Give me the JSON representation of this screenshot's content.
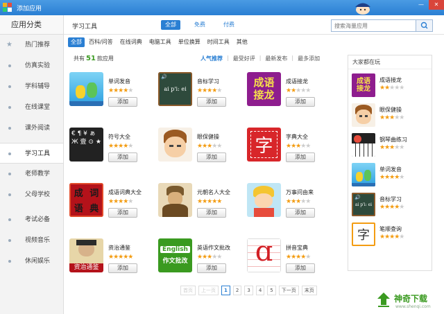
{
  "window": {
    "title": "添加应用"
  },
  "sidebar": {
    "header": "应用分类",
    "items": [
      {
        "label": "热门推荐"
      },
      {
        "label": "仿真实验"
      },
      {
        "label": "学科辅导"
      },
      {
        "label": "在线课堂"
      },
      {
        "label": "课外阅读"
      },
      {
        "label": "学习工具"
      },
      {
        "label": "老师教学"
      },
      {
        "label": "父母学校"
      },
      {
        "label": "考试必备"
      },
      {
        "label": "视频音乐"
      },
      {
        "label": "休闲娱乐"
      }
    ]
  },
  "topbar": {
    "title": "学习工具",
    "filters": [
      "全部",
      "免费",
      "付费"
    ],
    "search_placeholder": "搜索海量应用"
  },
  "subcategories": [
    "全部",
    "百科/问答",
    "在线词典",
    "电脑工具",
    "单位换算",
    "时间工具",
    "其他"
  ],
  "count": {
    "prefix": "共有",
    "number": "51",
    "suffix": "款应用"
  },
  "sorts": [
    "人气推荐",
    "最受好评",
    "最新发布",
    "最多添加"
  ],
  "add_label": "添加",
  "apps": [
    {
      "name": "单词发音",
      "rating": 4,
      "icon": "cartoon-kids-icon"
    },
    {
      "name": "音标学习",
      "rating": 4,
      "icon": "phonetic-icon"
    },
    {
      "name": "成语接龙",
      "rating": 2,
      "icon": "idiom-chain-icon",
      "icon_text": [
        "成语",
        "接龙"
      ]
    },
    {
      "name": "符号大全",
      "rating": 4,
      "icon": "symbols-icon",
      "icon_text": "€ ¶ ¥ ぁ Ж 壹 ⊙ ★"
    },
    {
      "name": "眼保健操",
      "rating": 3,
      "icon": "eye-exercise-icon"
    },
    {
      "name": "字典大全",
      "rating": 3,
      "icon": "dictionary-icon",
      "icon_text": "字"
    },
    {
      "name": "成语词典大全",
      "rating": 4,
      "icon": "idiom-dict-icon",
      "icon_text": [
        "成",
        "词",
        "语",
        "典"
      ]
    },
    {
      "name": "元朝名人大全",
      "rating": 5,
      "icon": "yuan-figure-icon"
    },
    {
      "name": "万事问由来",
      "rating": 3,
      "icon": "cartoon-boy-icon"
    },
    {
      "name": "资治通鉴",
      "rating": 5,
      "icon": "zizhi-icon",
      "icon_text": "资治通鉴"
    },
    {
      "name": "英语作文批改",
      "rating": 3,
      "icon": "english-essay-icon",
      "icon_text": [
        "English",
        "作文批改"
      ]
    },
    {
      "name": "拼音宝典",
      "rating": 4,
      "icon": "pinyin-icon",
      "icon_text": "ɑ"
    }
  ],
  "rail": {
    "title": "大家都在玩",
    "items": [
      {
        "name": "成语接龙",
        "rating": 2,
        "icon": "idiom-chain-icon",
        "icon_text": [
          "成语",
          "接龙"
        ]
      },
      {
        "name": "眼保健操",
        "rating": 3,
        "icon": "eye-exercise-icon"
      },
      {
        "name": "钢琴曲练习",
        "rating": 3,
        "icon": "piano-icon"
      },
      {
        "name": "单词发音",
        "rating": 4,
        "icon": "cartoon-kids-icon"
      },
      {
        "name": "音标学习",
        "rating": 4,
        "icon": "phonetic-icon"
      },
      {
        "name": "笔顺查询",
        "rating": 4,
        "icon": "stroke-order-icon",
        "icon_text": "字"
      }
    ]
  },
  "pager": {
    "first": "首页",
    "prev": "上一页",
    "pages": [
      "1",
      "2",
      "3",
      "4",
      "5"
    ],
    "current": "1",
    "next": "下一页",
    "last": "末页"
  },
  "watermark": {
    "text": "神奇下载",
    "url": "www.shenqi.com"
  },
  "colors": {
    "accent": "#2a7fd3",
    "star": "#f39c12",
    "green": "#3a9a20"
  }
}
